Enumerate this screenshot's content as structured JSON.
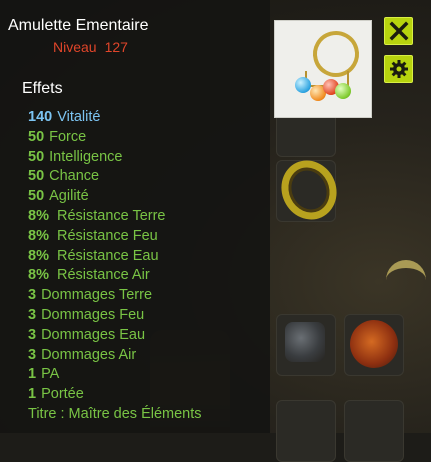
{
  "item": {
    "name": "Amulette Ementaire",
    "level_label": "Niveau",
    "level_value": "127"
  },
  "effects_header": "Effets",
  "effects": [
    {
      "value": "140",
      "label": "Vitalité",
      "color": "#7cc4f2"
    },
    {
      "value": "50",
      "label": "Force",
      "color": "#79c445"
    },
    {
      "value": "50",
      "label": "Intelligence",
      "color": "#79c445"
    },
    {
      "value": "50",
      "label": "Chance",
      "color": "#79c445"
    },
    {
      "value": "50",
      "label": "Agilité",
      "color": "#79c445"
    },
    {
      "value": "8%",
      "label": "Résistance Terre",
      "color": "#79c445"
    },
    {
      "value": "8%",
      "label": "Résistance Feu",
      "color": "#79c445"
    },
    {
      "value": "8%",
      "label": "Résistance Eau",
      "color": "#79c445"
    },
    {
      "value": "8%",
      "label": "Résistance Air",
      "color": "#79c445"
    },
    {
      "value": "3",
      "label": "Dommages Terre",
      "color": "#79c445"
    },
    {
      "value": "3",
      "label": "Dommages Feu",
      "color": "#79c445"
    },
    {
      "value": "3",
      "label": "Dommages Eau",
      "color": "#79c445"
    },
    {
      "value": "3",
      "label": "Dommages Air",
      "color": "#79c445"
    },
    {
      "value": "1",
      "label": "PA",
      "color": "#79c445"
    },
    {
      "value": "1",
      "label": "Portée",
      "color": "#79c445"
    }
  ],
  "title_line": "Titre : Maître des Éléments",
  "buttons": {
    "close_icon": "close-x-icon",
    "settings_icon": "gear-icon"
  },
  "colors": {
    "accent_button": "#b7d30e",
    "level_red": "#e0452a",
    "vitality_blue": "#7cc4f2",
    "stat_green": "#79c445"
  }
}
